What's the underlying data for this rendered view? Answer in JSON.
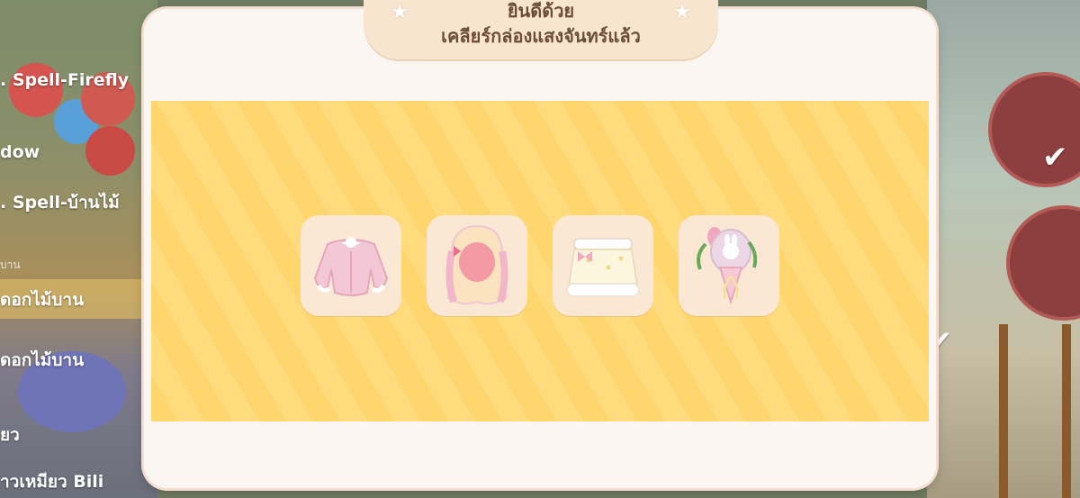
{
  "banner": {
    "title_line1": "ยินดีด้วย",
    "title_line2": "เคลียร์กล่องแสงจันทร์แล้ว"
  },
  "rewards": [
    {
      "name": "pink-cropped-jacket",
      "icon": "jacket-icon"
    },
    {
      "name": "pink-long-hair",
      "icon": "hair-icon"
    },
    {
      "name": "white-fluffy-skirt",
      "icon": "skirt-icon"
    },
    {
      "name": "bunny-flower-bouquet",
      "icon": "bouquet-icon"
    }
  ],
  "background": {
    "left_list": [
      {
        "label": ". Spell-Firefly"
      },
      {
        "label": "dow"
      },
      {
        "label": ". Spell-บ้านไม้"
      },
      {
        "label": "บาน"
      },
      {
        "label": "ดอกไม้บาน"
      },
      {
        "label": "ดอกไม้บาน"
      },
      {
        "label": "ยว"
      },
      {
        "label": "าวเหมียว Bili"
      }
    ]
  },
  "colors": {
    "dialog_bg": "#fbf6f1",
    "banner_bg": "#f7e5cf",
    "reward_stripe_a": "#ffd56e",
    "reward_stripe_b": "#ffdb7e",
    "card_bg": "#fbe8d4",
    "banner_text": "#6b4c3a"
  }
}
